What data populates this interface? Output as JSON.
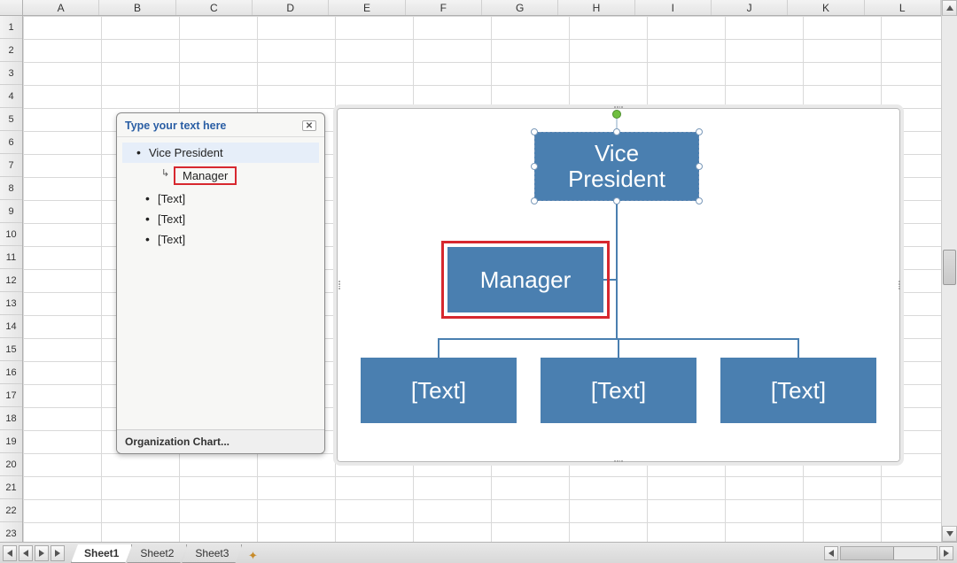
{
  "columns": [
    "A",
    "B",
    "C",
    "D",
    "E",
    "F",
    "G",
    "H",
    "I",
    "J",
    "K",
    "L"
  ],
  "rows": [
    "1",
    "2",
    "3",
    "4",
    "5",
    "6",
    "7",
    "8",
    "9",
    "10",
    "11",
    "12",
    "13",
    "14",
    "15",
    "16",
    "17",
    "18",
    "19",
    "20",
    "21",
    "22",
    "23"
  ],
  "textpane": {
    "title": "Type your text here",
    "items": [
      {
        "label": "Vice President",
        "level": "top",
        "selected": true
      },
      {
        "label": "Manager",
        "level": "sub",
        "highlight": true
      },
      {
        "label": "[Text]",
        "level": "child"
      },
      {
        "label": "[Text]",
        "level": "child"
      },
      {
        "label": "[Text]",
        "level": "child"
      }
    ],
    "footer": "Organization Chart..."
  },
  "org": {
    "vp": "Vice\nPresident",
    "mgr": "Manager",
    "leaf1": "[Text]",
    "leaf2": "[Text]",
    "leaf3": "[Text]"
  },
  "tabs": {
    "t1": "Sheet1",
    "t2": "Sheet2",
    "t3": "Sheet3"
  }
}
